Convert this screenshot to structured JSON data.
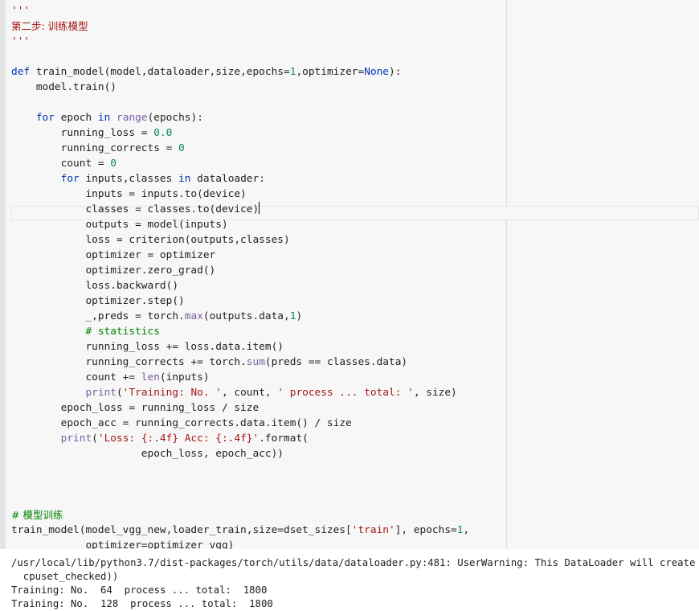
{
  "cell": {
    "code_lines": [
      "'''",
      "第二步: 训练模型",
      "'''",
      "",
      "def train_model(model,dataloader,size,epochs=1,optimizer=None):",
      "    model.train()",
      "",
      "    for epoch in range(epochs):",
      "        running_loss = 0.0",
      "        running_corrects = 0",
      "        count = 0",
      "        for inputs,classes in dataloader:",
      "            inputs = inputs.to(device)",
      "            classes = classes.to(device)",
      "            outputs = model(inputs)",
      "            loss = criterion(outputs,classes)",
      "            optimizer = optimizer",
      "            optimizer.zero_grad()",
      "            loss.backward()",
      "            optimizer.step()",
      "            _,preds = torch.max(outputs.data,1)",
      "            # statistics",
      "            running_loss += loss.data.item()",
      "            running_corrects += torch.sum(preds == classes.data)",
      "            count += len(inputs)",
      "            print('Training: No. ', count, ' process ... total: ', size)",
      "        epoch_loss = running_loss / size",
      "        epoch_acc = running_corrects.data.item() / size",
      "        print('Loss: {:.4f} Acc: {:.4f}'.format(",
      "                     epoch_loss, epoch_acc))",
      "",
      "",
      "",
      "# 模型训练",
      "train_model(model_vgg_new,loader_train,size=dset_sizes['train'], epochs=1,",
      "            optimizer=optimizer_vgg)"
    ]
  },
  "output": {
    "lines": [
      "/usr/local/lib/python3.7/dist-packages/torch/utils/data/dataloader.py:481: UserWarning: This DataLoader will create",
      "  cpuset_checked))",
      "Training: No.  64  process ... total:  1800",
      "Training: No.  128  process ... total:  1800"
    ]
  },
  "colors": {
    "keyword": "#0033b3",
    "builtin": "#795da3",
    "number": "#098658",
    "string": "#a31515",
    "comment": "#008000"
  }
}
